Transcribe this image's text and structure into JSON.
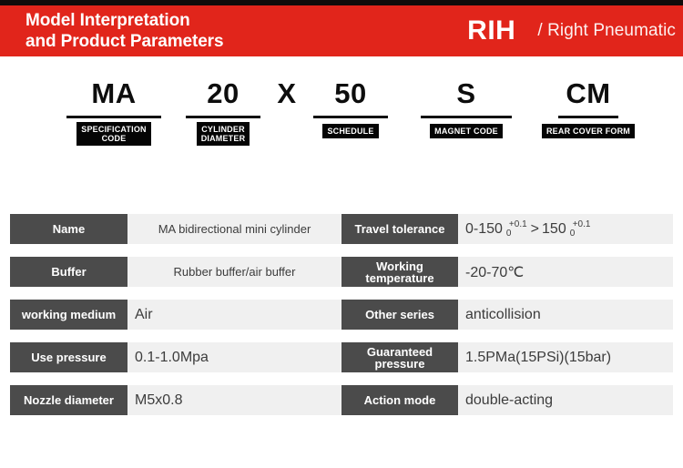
{
  "header": {
    "title": "Model Interpretation\nand Product Parameters",
    "brand": "RIH",
    "brand_sub": "/ Right Pneumatic",
    "accent_color": "#e1251b",
    "strip_color": "#100c0b"
  },
  "model_breakdown": {
    "segments": [
      {
        "code": "MA",
        "badge": "SPECIFICATION\nCODE",
        "has_rule": true,
        "has_badge": true
      },
      {
        "code": "20",
        "badge": "CYLINDER\nDIAMETER",
        "has_rule": true,
        "has_badge": true
      },
      {
        "code": "X",
        "badge": "",
        "has_rule": false,
        "has_badge": false
      },
      {
        "code": "50",
        "badge": "SCHEDULE",
        "has_rule": true,
        "has_badge": true
      },
      {
        "code": "S",
        "badge": "MAGNET CODE",
        "has_rule": true,
        "has_badge": true
      },
      {
        "code": "CM",
        "badge": "REAR COVER FORM",
        "has_rule": true,
        "has_badge": true
      }
    ]
  },
  "parameters": {
    "label_color": "#4b4b4b",
    "value_bg": "#f0f0f0",
    "rows": [
      {
        "left_label": "Name",
        "left_value": "MA bidirectional mini cylinder",
        "right_label": "Travel tolerance",
        "right_value": "0-150 +0.1/0 > 150 +0.1/0",
        "tolerance": {
          "range1": "0-150",
          "upper1": "+0.1",
          "lower1": "0",
          "separator": ">",
          "range2": "150",
          "upper2": "+0.1",
          "lower2": "0"
        }
      },
      {
        "left_label": "Buffer",
        "left_value": "Rubber buffer/air buffer",
        "right_label": "Working\ntemperature",
        "right_value": "-20-70℃"
      },
      {
        "left_label": "working medium",
        "left_value": "Air",
        "right_label": "Other series",
        "right_value": "anticollision"
      },
      {
        "left_label": "Use pressure",
        "left_value": "0.1-1.0Mpa",
        "right_label": "Guaranteed\npressure",
        "right_value": "1.5PMa(15PSi)(15bar)"
      },
      {
        "left_label": "Nozzle diameter",
        "left_value": "M5x0.8",
        "right_label": "Action mode",
        "right_value": "double-acting"
      }
    ]
  }
}
